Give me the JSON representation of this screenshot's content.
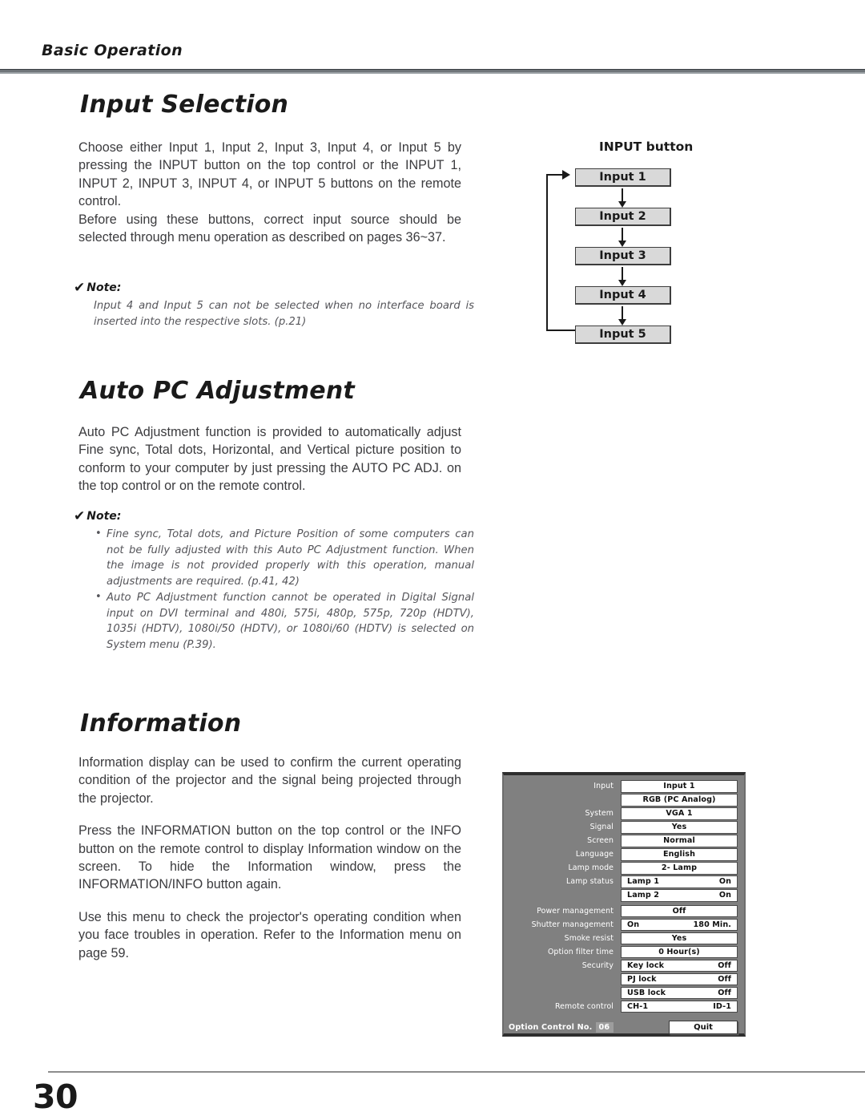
{
  "page": {
    "running_head": "Basic Operation",
    "page_number": "30"
  },
  "sections": {
    "input_selection": {
      "heading": "Input Selection",
      "paragraphs": [
        "Choose either Input 1, Input 2, Input 3, Input 4, or Input 5 by pressing the INPUT button on the top control or the INPUT 1, INPUT 2, INPUT 3, INPUT 4, or INPUT 5 buttons on the remote control.",
        "Before using these buttons, correct input source should be selected through menu operation as described on pages 36~37."
      ],
      "note": {
        "check": "✔",
        "title": "Note:",
        "text": "Input 4 and Input 5 can not be selected when no interface board is inserted into the respective slots. (p.21)"
      },
      "diagram": {
        "title": "INPUT button",
        "boxes": [
          "Input 1",
          "Input 2",
          "Input 3",
          "Input 4",
          "Input 5"
        ]
      }
    },
    "auto_pc_adjustment": {
      "heading": "Auto PC Adjustment",
      "paragraphs": [
        "Auto PC Adjustment function is provided to automatically adjust Fine sync, Total dots, Horizontal, and Vertical picture position to conform to your computer by just pressing the AUTO PC ADJ. on the top control or on the remote control."
      ],
      "note": {
        "check": "✔",
        "title": "Note:",
        "items": [
          "Fine sync, Total dots, and Picture Position of some computers can not be fully adjusted with this Auto PC Adjustment function. When the image is not provided properly with this operation, manual adjustments are required. (p.41, 42)",
          "Auto PC Adjustment function cannot be operated in Digital Signal input on DVI terminal and 480i, 575i, 480p, 575p, 720p (HDTV), 1035i (HDTV), 1080i/50 (HDTV), or 1080i/60 (HDTV) is selected on System menu (P.39)."
        ]
      }
    },
    "information": {
      "heading": "Information",
      "paragraphs": [
        "Information display can be used to confirm the current operating condition of the projector and the signal being projected through the projector.",
        "Press the INFORMATION button on the top control or the INFO button on the remote control to display Information window on the screen. To hide the Information window, press the INFORMATION/INFO button again.",
        "Use this menu to check the projector's operating condition when you face troubles in operation. Refer to the Information menu on page 59."
      ]
    }
  },
  "info_panel": {
    "rows": [
      {
        "label": "Input",
        "value": "Input 1",
        "layout": "center"
      },
      {
        "label": "",
        "value": "RGB (PC Analog)",
        "layout": "center"
      },
      {
        "label": "System",
        "value": "VGA 1",
        "layout": "center"
      },
      {
        "label": "Signal",
        "value": "Yes",
        "layout": "center"
      },
      {
        "label": "Screen",
        "value": "Normal",
        "layout": "center"
      },
      {
        "label": "Language",
        "value": "English",
        "layout": "center"
      },
      {
        "label": "Lamp mode",
        "value": "2- Lamp",
        "layout": "center"
      },
      {
        "label": "Lamp status",
        "left": "Lamp 1",
        "right": "On",
        "layout": "split"
      },
      {
        "label": "",
        "left": "Lamp 2",
        "right": "On",
        "layout": "split"
      },
      {
        "label": "Power management",
        "value": "Off",
        "layout": "center"
      },
      {
        "label": "Shutter management",
        "left": "On",
        "right": "180 Min.",
        "layout": "split"
      },
      {
        "label": "Smoke resist",
        "value": "Yes",
        "layout": "center"
      },
      {
        "label": "Option filter time",
        "value": "0 Hour(s)",
        "layout": "center"
      },
      {
        "label": "Security",
        "left": "Key lock",
        "right": "Off",
        "layout": "split"
      },
      {
        "label": "",
        "left": "PJ lock",
        "right": "Off",
        "layout": "split"
      },
      {
        "label": "",
        "left": "USB lock",
        "right": "Off",
        "layout": "split"
      },
      {
        "label": "Remote control",
        "left": "CH-1",
        "right": "ID-1",
        "layout": "split"
      }
    ],
    "footer": {
      "option_control_label": "Option Control No.",
      "option_control_value": "06",
      "quit_label": "Quit"
    }
  },
  "colors": {
    "osd_background": "#808080",
    "osd_value_bg": "#ffffff",
    "flow_box_bg": "#d9d9d9",
    "rule": "#6f7579",
    "text": "#231f20"
  }
}
